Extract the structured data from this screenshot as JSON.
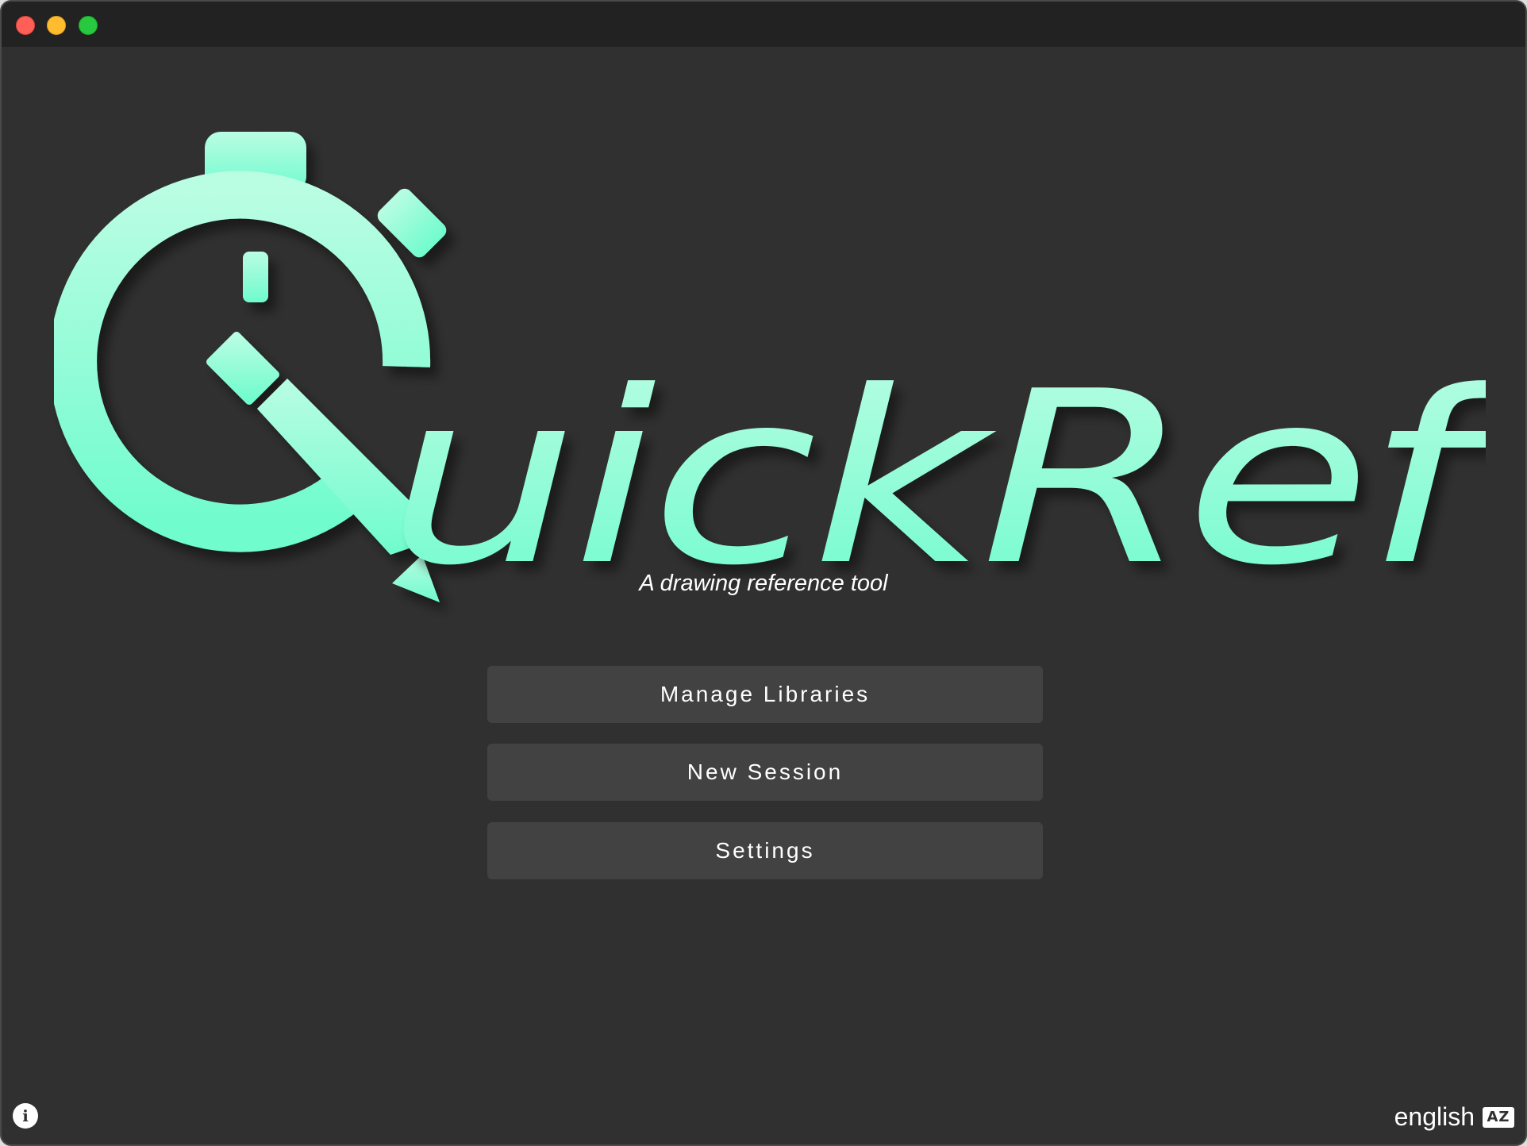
{
  "window": {
    "controls": [
      "close",
      "minimize",
      "maximize"
    ]
  },
  "logo": {
    "text": "QuickRef",
    "icon": "stopwatch-pencil-icon",
    "color": "#7dfcd0"
  },
  "subtitle": "A drawing reference tool",
  "menu": {
    "manage_libraries": "Manage Libraries",
    "new_session": "New Session",
    "settings": "Settings"
  },
  "footer": {
    "info_icon": "i",
    "language": "english",
    "language_icon": "AZ"
  },
  "colors": {
    "background": "#303030",
    "titlebar": "#222222",
    "button": "#424242",
    "accent": "#7dfcd0"
  }
}
